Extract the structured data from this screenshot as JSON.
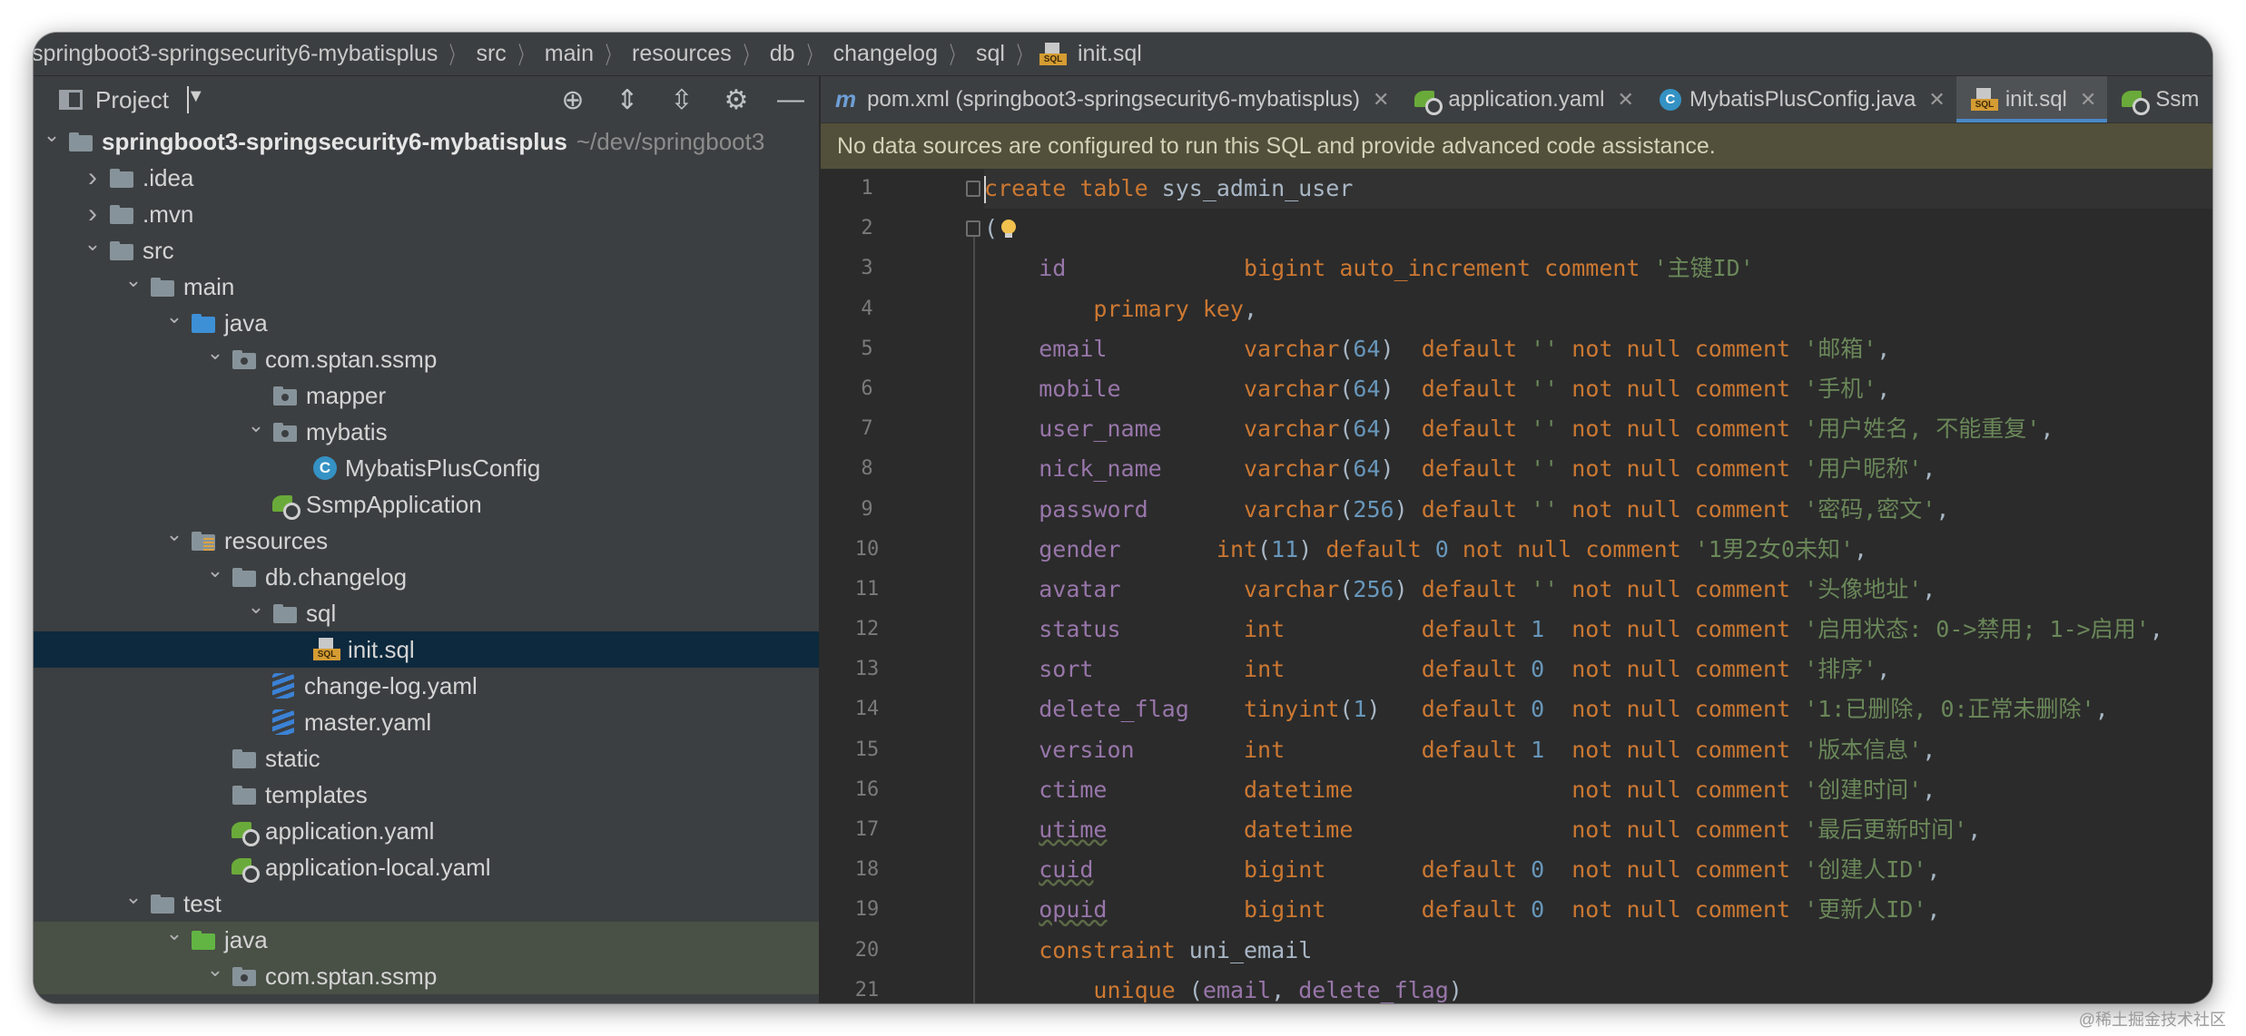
{
  "breadcrumb": {
    "items": [
      "springboot3-springsecurity6-mybatisplus",
      "src",
      "main",
      "resources",
      "db",
      "changelog",
      "sql",
      "init.sql"
    ]
  },
  "project_panel": {
    "title": "Project",
    "tools": [
      "target-icon",
      "expand-all-icon",
      "collapse-all-icon",
      "gear-icon",
      "minimize-icon"
    ],
    "tree": [
      {
        "label": "springboot3-springsecurity6-mybatisplus",
        "extra": "~/dev/springboot3",
        "icon": "module-folder-icon",
        "depth": 0,
        "expanded": true,
        "bold": true
      },
      {
        "label": ".idea",
        "icon": "folder-icon",
        "depth": 1,
        "expanded": false
      },
      {
        "label": ".mvn",
        "icon": "folder-icon",
        "depth": 1,
        "expanded": false
      },
      {
        "label": "src",
        "icon": "folder-icon",
        "depth": 1,
        "expanded": true
      },
      {
        "label": "main",
        "icon": "folder-icon",
        "depth": 2,
        "expanded": true
      },
      {
        "label": "java",
        "icon": "source-folder-icon",
        "depth": 3,
        "expanded": true
      },
      {
        "label": "com.sptan.ssmp",
        "icon": "package-icon",
        "depth": 4,
        "expanded": true
      },
      {
        "label": "mapper",
        "icon": "package-icon",
        "depth": 5,
        "expanded": null
      },
      {
        "label": "mybatis",
        "icon": "package-icon",
        "depth": 5,
        "expanded": true
      },
      {
        "label": "MybatisPlusConfig",
        "icon": "java-class-icon",
        "depth": 6,
        "expanded": null
      },
      {
        "label": "SsmpApplication",
        "icon": "spring-boot-class-icon",
        "depth": 5,
        "expanded": null
      },
      {
        "label": "resources",
        "icon": "resources-folder-icon",
        "depth": 3,
        "expanded": true
      },
      {
        "label": "db.changelog",
        "icon": "folder-icon",
        "depth": 4,
        "expanded": true
      },
      {
        "label": "sql",
        "icon": "folder-icon",
        "depth": 5,
        "expanded": true
      },
      {
        "label": "init.sql",
        "icon": "sql-file-icon",
        "depth": 6,
        "expanded": null,
        "selected": true
      },
      {
        "label": "change-log.yaml",
        "icon": "yaml-file-icon",
        "depth": 5,
        "expanded": null
      },
      {
        "label": "master.yaml",
        "icon": "yaml-file-icon",
        "depth": 5,
        "expanded": null
      },
      {
        "label": "static",
        "icon": "folder-icon",
        "depth": 4,
        "expanded": null
      },
      {
        "label": "templates",
        "icon": "folder-icon",
        "depth": 4,
        "expanded": null
      },
      {
        "label": "application.yaml",
        "icon": "spring-config-icon",
        "depth": 4,
        "expanded": null
      },
      {
        "label": "application-local.yaml",
        "icon": "spring-config-icon",
        "depth": 4,
        "expanded": null
      },
      {
        "label": "test",
        "icon": "folder-icon",
        "depth": 2,
        "expanded": true
      },
      {
        "label": "java",
        "icon": "test-source-folder-icon",
        "depth": 3,
        "expanded": true,
        "test": true
      },
      {
        "label": "com.sptan.ssmp",
        "icon": "package-icon",
        "depth": 4,
        "expanded": true,
        "test": true
      }
    ]
  },
  "editor": {
    "tabs": [
      {
        "label": "pom.xml (springboot3-springsecurity6-mybatisplus)",
        "icon": "maven-icon",
        "active": false
      },
      {
        "label": "application.yaml",
        "icon": "spring-config-icon",
        "active": false
      },
      {
        "label": "MybatisPlusConfig.java",
        "icon": "java-class-icon",
        "active": false
      },
      {
        "label": "init.sql",
        "icon": "sql-file-icon",
        "active": true
      },
      {
        "label": "Ssm",
        "icon": "spring-boot-class-icon",
        "active": false
      }
    ],
    "banner": "No data sources are configured to run this SQL and provide advanced code assistance.",
    "lines": [
      [
        [
          "kw",
          "create table "
        ],
        [
          "plain",
          "sys_admin_user"
        ]
      ],
      [
        [
          "plain",
          "("
        ]
      ],
      [
        [
          "plain",
          "    "
        ],
        [
          "id",
          "id"
        ],
        [
          "plain",
          "             "
        ],
        [
          "kw",
          "bigint auto_increment comment "
        ],
        [
          "str",
          "'主键ID'"
        ]
      ],
      [
        [
          "plain",
          "        "
        ],
        [
          "kw",
          "primary key"
        ],
        [
          "plain",
          ","
        ]
      ],
      [
        [
          "plain",
          "    "
        ],
        [
          "id",
          "email"
        ],
        [
          "plain",
          "          "
        ],
        [
          "kw",
          "varchar"
        ],
        [
          "plain",
          "("
        ],
        [
          "num",
          "64"
        ],
        [
          "plain",
          ")  "
        ],
        [
          "kw",
          "default "
        ],
        [
          "str",
          "''"
        ],
        [
          "kw",
          " not null comment "
        ],
        [
          "str",
          "'邮箱'"
        ],
        [
          "plain",
          ","
        ]
      ],
      [
        [
          "plain",
          "    "
        ],
        [
          "id",
          "mobile"
        ],
        [
          "plain",
          "         "
        ],
        [
          "kw",
          "varchar"
        ],
        [
          "plain",
          "("
        ],
        [
          "num",
          "64"
        ],
        [
          "plain",
          ")  "
        ],
        [
          "kw",
          "default "
        ],
        [
          "str",
          "''"
        ],
        [
          "kw",
          " not null comment "
        ],
        [
          "str",
          "'手机'"
        ],
        [
          "plain",
          ","
        ]
      ],
      [
        [
          "plain",
          "    "
        ],
        [
          "id",
          "user_name"
        ],
        [
          "plain",
          "      "
        ],
        [
          "kw",
          "varchar"
        ],
        [
          "plain",
          "("
        ],
        [
          "num",
          "64"
        ],
        [
          "plain",
          ")  "
        ],
        [
          "kw",
          "default "
        ],
        [
          "str",
          "''"
        ],
        [
          "kw",
          " not null comment "
        ],
        [
          "str",
          "'用户姓名, 不能重复'"
        ],
        [
          "plain",
          ","
        ]
      ],
      [
        [
          "plain",
          "    "
        ],
        [
          "id",
          "nick_name"
        ],
        [
          "plain",
          "      "
        ],
        [
          "kw",
          "varchar"
        ],
        [
          "plain",
          "("
        ],
        [
          "num",
          "64"
        ],
        [
          "plain",
          ")  "
        ],
        [
          "kw",
          "default "
        ],
        [
          "str",
          "''"
        ],
        [
          "kw",
          " not null comment "
        ],
        [
          "str",
          "'用户昵称'"
        ],
        [
          "plain",
          ","
        ]
      ],
      [
        [
          "plain",
          "    "
        ],
        [
          "id",
          "password"
        ],
        [
          "plain",
          "       "
        ],
        [
          "kw",
          "varchar"
        ],
        [
          "plain",
          "("
        ],
        [
          "num",
          "256"
        ],
        [
          "plain",
          ") "
        ],
        [
          "kw",
          "default "
        ],
        [
          "str",
          "''"
        ],
        [
          "kw",
          " not null comment "
        ],
        [
          "str",
          "'密码,密文'"
        ],
        [
          "plain",
          ","
        ]
      ],
      [
        [
          "plain",
          "    "
        ],
        [
          "id",
          "gender"
        ],
        [
          "plain",
          "       "
        ],
        [
          "kw",
          "int"
        ],
        [
          "plain",
          "("
        ],
        [
          "num",
          "11"
        ],
        [
          "plain",
          ") "
        ],
        [
          "kw",
          "default "
        ],
        [
          "num",
          "0"
        ],
        [
          "kw",
          " not null comment "
        ],
        [
          "str",
          "'1男2女0未知'"
        ],
        [
          "plain",
          ","
        ]
      ],
      [
        [
          "plain",
          "    "
        ],
        [
          "id",
          "avatar"
        ],
        [
          "plain",
          "         "
        ],
        [
          "kw",
          "varchar"
        ],
        [
          "plain",
          "("
        ],
        [
          "num",
          "256"
        ],
        [
          "plain",
          ") "
        ],
        [
          "kw",
          "default "
        ],
        [
          "str",
          "''"
        ],
        [
          "kw",
          " not null comment "
        ],
        [
          "str",
          "'头像地址'"
        ],
        [
          "plain",
          ","
        ]
      ],
      [
        [
          "plain",
          "    "
        ],
        [
          "id",
          "status"
        ],
        [
          "plain",
          "         "
        ],
        [
          "kw",
          "int"
        ],
        [
          "plain",
          "          "
        ],
        [
          "kw",
          "default "
        ],
        [
          "num",
          "1"
        ],
        [
          "kw",
          "  not null comment "
        ],
        [
          "str",
          "'启用状态: 0->禁用; 1->启用'"
        ],
        [
          "plain",
          ","
        ]
      ],
      [
        [
          "plain",
          "    "
        ],
        [
          "id",
          "sort"
        ],
        [
          "plain",
          "           "
        ],
        [
          "kw",
          "int"
        ],
        [
          "plain",
          "          "
        ],
        [
          "kw",
          "default "
        ],
        [
          "num",
          "0"
        ],
        [
          "kw",
          "  not null comment "
        ],
        [
          "str",
          "'排序'"
        ],
        [
          "plain",
          ","
        ]
      ],
      [
        [
          "plain",
          "    "
        ],
        [
          "id",
          "delete_flag"
        ],
        [
          "plain",
          "    "
        ],
        [
          "kw",
          "tinyint"
        ],
        [
          "plain",
          "("
        ],
        [
          "num",
          "1"
        ],
        [
          "plain",
          ")   "
        ],
        [
          "kw",
          "default "
        ],
        [
          "num",
          "0"
        ],
        [
          "kw",
          "  not null comment "
        ],
        [
          "str",
          "'1:已删除, 0:正常未删除'"
        ],
        [
          "plain",
          ","
        ]
      ],
      [
        [
          "plain",
          "    "
        ],
        [
          "id",
          "version"
        ],
        [
          "plain",
          "        "
        ],
        [
          "kw",
          "int"
        ],
        [
          "plain",
          "          "
        ],
        [
          "kw",
          "default "
        ],
        [
          "num",
          "1"
        ],
        [
          "kw",
          "  not null comment "
        ],
        [
          "str",
          "'版本信息'"
        ],
        [
          "plain",
          ","
        ]
      ],
      [
        [
          "plain",
          "    "
        ],
        [
          "id",
          "ctime"
        ],
        [
          "plain",
          "          "
        ],
        [
          "kw",
          "datetime"
        ],
        [
          "plain",
          "                "
        ],
        [
          "kw",
          "not null comment "
        ],
        [
          "str",
          "'创建时间'"
        ],
        [
          "plain",
          ","
        ]
      ],
      [
        [
          "plain",
          "    "
        ],
        [
          "idu",
          "utime"
        ],
        [
          "plain",
          "          "
        ],
        [
          "kw",
          "datetime"
        ],
        [
          "plain",
          "                "
        ],
        [
          "kw",
          "not null comment "
        ],
        [
          "str",
          "'最后更新时间'"
        ],
        [
          "plain",
          ","
        ]
      ],
      [
        [
          "plain",
          "    "
        ],
        [
          "idu",
          "cuid"
        ],
        [
          "plain",
          "           "
        ],
        [
          "kw",
          "bigint"
        ],
        [
          "plain",
          "       "
        ],
        [
          "kw",
          "default "
        ],
        [
          "num",
          "0"
        ],
        [
          "kw",
          "  not null comment "
        ],
        [
          "str",
          "'创建人ID'"
        ],
        [
          "plain",
          ","
        ]
      ],
      [
        [
          "plain",
          "    "
        ],
        [
          "idu",
          "opuid"
        ],
        [
          "plain",
          "          "
        ],
        [
          "kw",
          "bigint"
        ],
        [
          "plain",
          "       "
        ],
        [
          "kw",
          "default "
        ],
        [
          "num",
          "0"
        ],
        [
          "kw",
          "  not null comment "
        ],
        [
          "str",
          "'更新人ID'"
        ],
        [
          "plain",
          ","
        ]
      ],
      [
        [
          "plain",
          "    "
        ],
        [
          "kw",
          "constraint "
        ],
        [
          "plain",
          "uni_email"
        ]
      ],
      [
        [
          "plain",
          "        "
        ],
        [
          "kw",
          "unique "
        ],
        [
          "plain",
          "("
        ],
        [
          "id",
          "email"
        ],
        [
          "plain",
          ", "
        ],
        [
          "id",
          "delete_flag"
        ],
        [
          "plain",
          ")"
        ]
      ]
    ]
  },
  "watermark": "@稀土掘金技术社区",
  "colors": {
    "keyword": "#cc7832",
    "string": "#6a8759",
    "number": "#6897bb",
    "column": "#9876aa",
    "selection": "#0d293e",
    "tab_underline": "#4a88c7"
  }
}
